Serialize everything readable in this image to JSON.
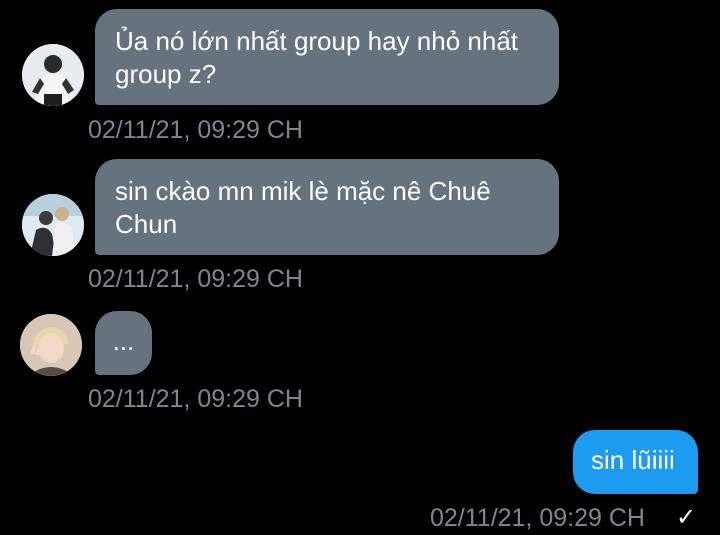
{
  "messages": [
    {
      "direction": "in",
      "avatar_icon": "user-avatar-1",
      "text": "Ủa nó lớn nhất group hay nhỏ nhất group z?",
      "time": "02/11/21, 09:29 CH"
    },
    {
      "direction": "in",
      "avatar_icon": "user-avatar-2",
      "text": "sin ckào mn mik lè mặc nê Chuê Chun",
      "time": "02/11/21, 09:29 CH"
    },
    {
      "direction": "in",
      "avatar_icon": "user-avatar-3",
      "text": "...",
      "time": "02/11/21, 09:29 CH"
    },
    {
      "direction": "out",
      "text": "sin lũiiii",
      "time": "02/11/21, 09:29 CH",
      "status_icon": "checkmark-icon",
      "status_glyph": "✓"
    }
  ],
  "colors": {
    "background": "#000000",
    "incoming_bubble": "#66737f",
    "outgoing_bubble": "#1d9bf0",
    "timestamp": "#7b8792"
  }
}
